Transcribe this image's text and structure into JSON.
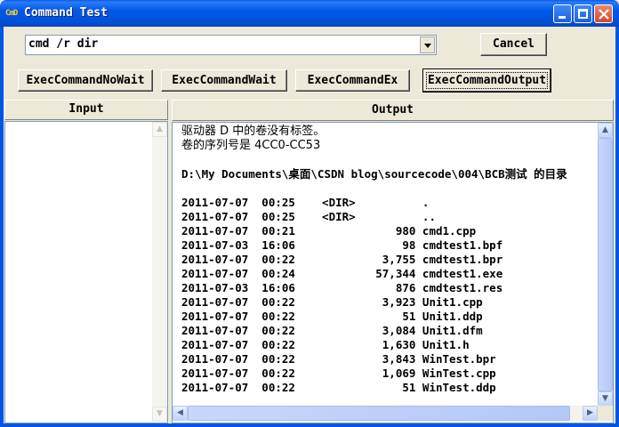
{
  "window": {
    "title": "Command Test",
    "app_icon_text": "CmD",
    "controls": {
      "minimize": "_",
      "maximize": "□",
      "close": "✕"
    }
  },
  "command": {
    "value": "cmd /r dir",
    "arrow": "▼"
  },
  "buttons": {
    "cancel": "Cancel",
    "exec_nowait": "ExecCommandNoWait",
    "exec_wait": "ExecCommandWait",
    "exec_ex": "ExecCommandEx",
    "exec_output": "ExecCommandOutput"
  },
  "panels": {
    "input_header": "Input",
    "output_header": "Output"
  },
  "scroll_arrows": {
    "up": "▲",
    "down": "▼",
    "left": "◀",
    "right": "▶"
  },
  "output": {
    "lines": [
      "驱动器 D 中的卷没有标签。",
      "卷的序列号是 4CC0-CC53",
      "",
      "D:\\My Documents\\桌面\\CSDN blog\\sourcecode\\004\\BCB测试 的目录",
      "",
      "2011-07-07  00:25    <DIR>          .",
      "2011-07-07  00:25    <DIR>          ..",
      "2011-07-07  00:21               980 cmd1.cpp",
      "2011-07-03  16:06                98 cmdtest1.bpf",
      "2011-07-07  00:22             3,755 cmdtest1.bpr",
      "2011-07-07  00:24            57,344 cmdtest1.exe",
      "2011-07-03  16:06               876 cmdtest1.res",
      "2011-07-07  00:22             3,923 Unit1.cpp",
      "2011-07-07  00:22                51 Unit1.ddp",
      "2011-07-07  00:22             3,084 Unit1.dfm",
      "2011-07-07  00:22             1,630 Unit1.h",
      "2011-07-07  00:22             3,843 WinTest.bpr",
      "2011-07-07  00:22             1,069 WinTest.cpp",
      "2011-07-07  00:22                51 WinTest.ddp"
    ]
  }
}
